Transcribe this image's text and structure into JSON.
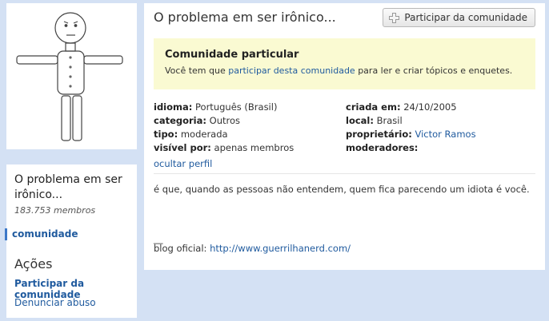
{
  "community": {
    "name": "O problema em ser irônico...",
    "member_count": "183.753 membros"
  },
  "sidebar": {
    "nav_item": "comunidade",
    "actions_title": "Ações",
    "join_link": "Participar da comunidade",
    "report_link": "Denunciar abuso"
  },
  "header": {
    "title": "O problema em ser irônico...",
    "join_button": "Participar da comunidade"
  },
  "private_notice": {
    "title": "Comunidade particular",
    "msg_before": "Você tem que ",
    "msg_link": "participar desta comunidade",
    "msg_after": " para ler e criar tópicos e enquetes."
  },
  "details": {
    "left": [
      {
        "label": "idioma:",
        "value": "Português (Brasil)"
      },
      {
        "label": "categoria:",
        "value": "Outros"
      },
      {
        "label": "tipo:",
        "value": "moderada"
      },
      {
        "label": "visível por:",
        "value": "apenas membros"
      }
    ],
    "right": [
      {
        "label": "criada em:",
        "value": "24/10/2005"
      },
      {
        "label": "local:",
        "value": "Brasil"
      },
      {
        "label": "proprietário:",
        "value": "Victor Ramos"
      },
      {
        "label": "moderadores:",
        "value": ""
      }
    ]
  },
  "hide_profile_link": "ocultar perfil",
  "description": "é que, quando as pessoas não entendem, quem fica parecendo um idiota é você.",
  "dash": "__",
  "blog": {
    "label": "blog oficial: ",
    "url": "http://www.guerrilhanerd.com/"
  },
  "icons": {
    "join": "plus-icon"
  },
  "colors": {
    "background": "#d4e1f4",
    "link": "#1f5a9e",
    "notice_bg": "#fafad2",
    "nav_accent": "#3c78c8"
  }
}
